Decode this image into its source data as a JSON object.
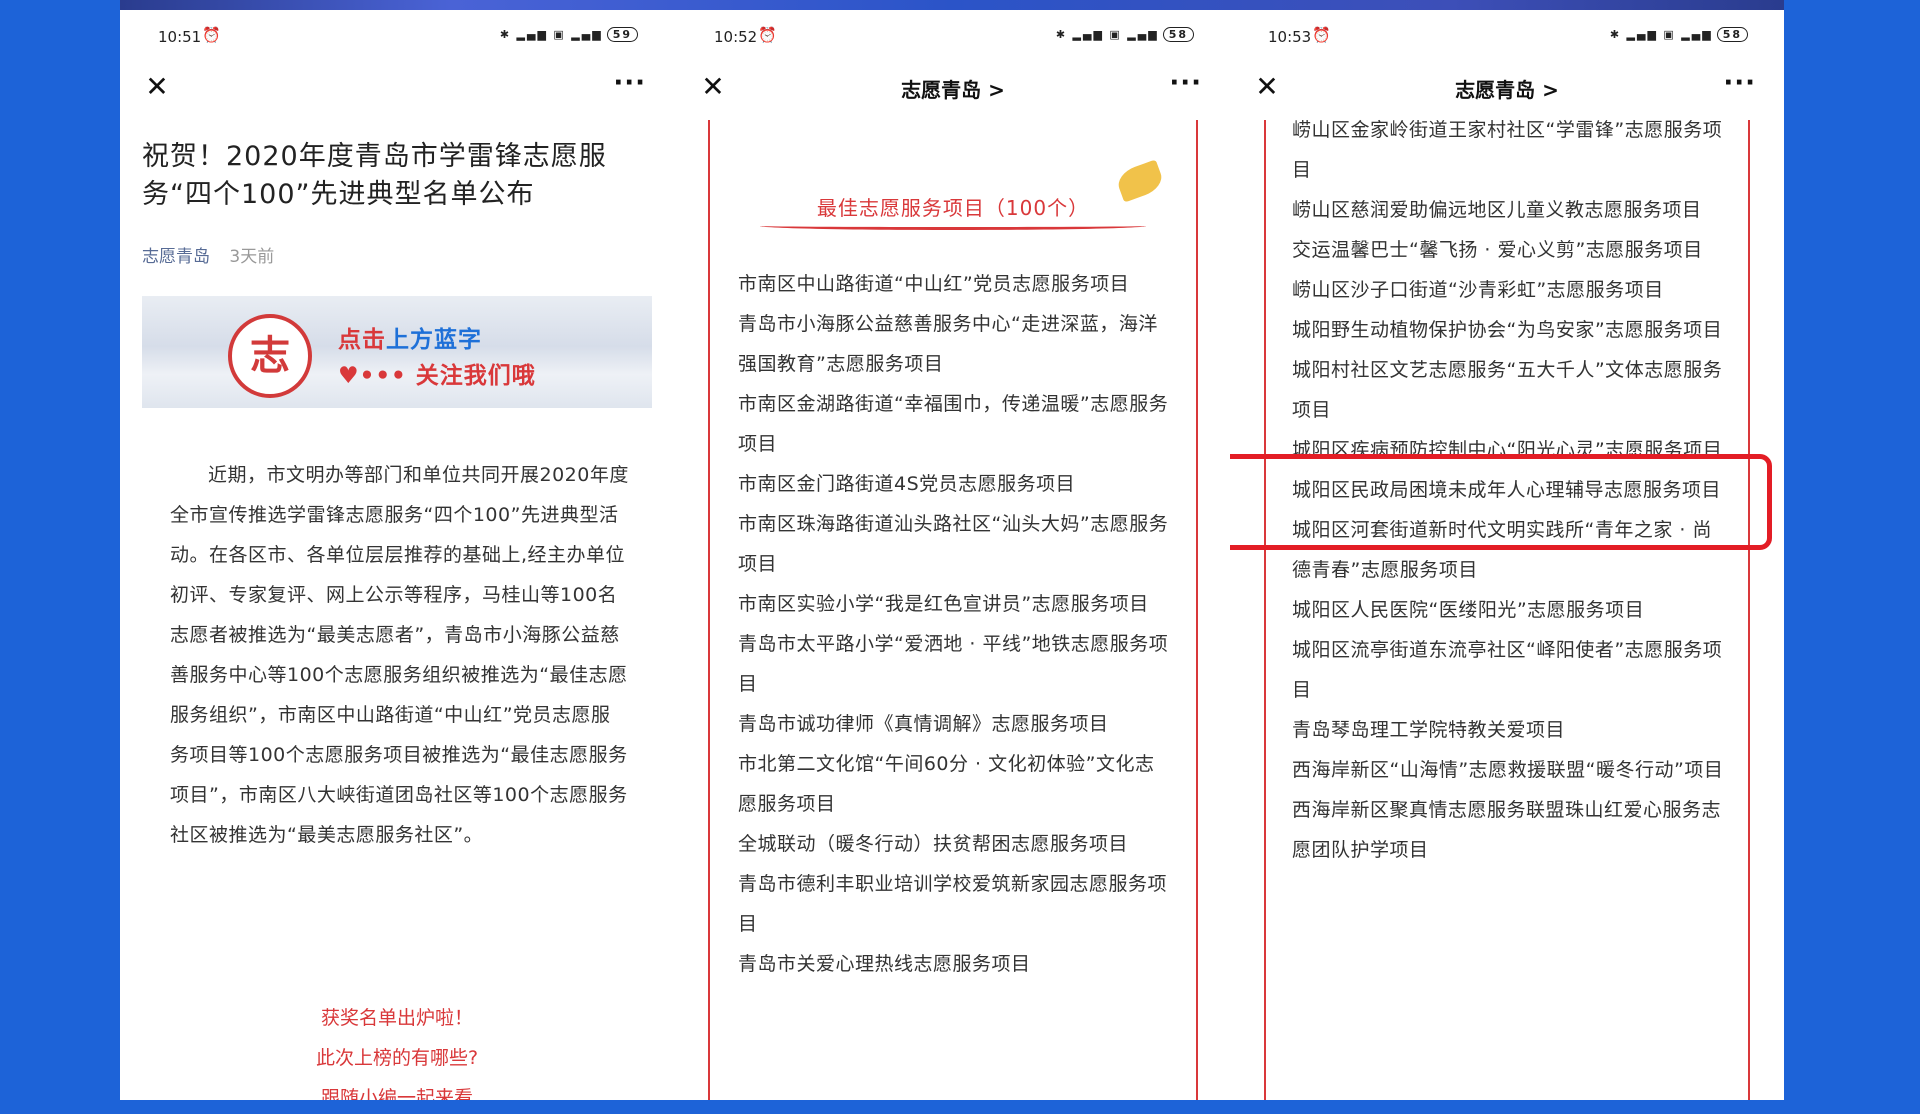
{
  "colors": {
    "background": "#1d63d8",
    "accent_red": "#d9383a",
    "link_blue": "#576b95",
    "highlight": "#e31d25"
  },
  "phone1": {
    "status": {
      "time": "10:51",
      "battery": "59"
    },
    "article": {
      "title": "祝贺！2020年度青岛市学雷锋志愿服务“四个100”先进典型名单公布",
      "account": "志愿青岛",
      "time_ago": "3天前",
      "banner": {
        "line1_part1": "点击",
        "line1_part2": "上方蓝字",
        "line2": "关注我们哦",
        "logo_icon": "volunteer-logo"
      },
      "body": "近期，市文明办等部门和单位共同开展2020年度全市宣传推选学雷锋志愿服务“四个100”先进典型活动。在各区市、各单位层层推荐的基础上,经主办单位初评、专家复评、网上公示等程序，马桂山等100名志愿者被推选为“最美志愿者”，青岛市小海豚公益慈善服务中心等100个志愿服务组织被推选为“最佳志愿服务组织”，市南区中山路街道“中山红”党员志愿服务项目等100个志愿服务项目被推选为“最佳志愿服务项目”，市南区八大峡街道团岛社区等100个志愿服务社区被推选为“最美志愿服务社区”。",
      "red_lines": [
        "获奖名单出炉啦！",
        "此次上榜的有哪些?",
        "跟随小编一起来看"
      ]
    }
  },
  "phone2": {
    "status": {
      "time": "10:52",
      "battery": "58"
    },
    "nav_title": "志愿青岛 >",
    "section_label": "最佳志愿服务项目（100个）",
    "items": [
      "市南区中山路街道“中山红”党员志愿服务项目",
      "青岛市小海豚公益慈善服务中心“走进深蓝，海洋强国教育”志愿服务项目",
      "市南区金湖路街道“幸福围巾，传递温暖”志愿服务项目",
      "市南区金门路街道4S党员志愿服务项目",
      "市南区珠海路街道汕头路社区“汕头大妈”志愿服务项目",
      "市南区实验小学“我是红色宣讲员”志愿服务项目",
      "青岛市太平路小学“爱洒地 · 平线”地铁志愿服务项目",
      "青岛市诚功律师《真情调解》志愿服务项目",
      "市北第二文化馆“午间60分 · 文化初体验”文化志愿服务项目",
      "全城联动（暖冬行动）扶贫帮困志愿服务项目",
      "青岛市德利丰职业培训学校爱筑新家园志愿服务项目",
      "青岛市关爱心理热线志愿服务项目"
    ]
  },
  "phone3": {
    "status": {
      "time": "10:53",
      "battery": "58"
    },
    "nav_title": "志愿青岛 >",
    "items": [
      "崂山区金家岭街道王家村社区“学雷锋”志愿服务项目",
      "崂山区慈润爱助偏远地区儿童义教志愿服务项目",
      "交运温馨巴士“馨飞扬 · 爱心义剪”志愿服务项目",
      "崂山区沙子口街道“沙青彩虹”志愿服务项目",
      "城阳野生动植物保护协会“为鸟安家”志愿服务项目",
      "城阳村社区文艺志愿服务“五大千人”文体志愿服务项目",
      "城阳区疾病预防控制中心“阳光心灵”志愿服务项目",
      "城阳区民政局困境未成年人心理辅导志愿服务项目",
      "城阳区河套街道新时代文明实践所“青年之家 · 尚德青春”志愿服务项目",
      "城阳区人民医院“医缕阳光”志愿服务项目",
      "城阳区流亭街道东流亭社区“峄阳使者”志愿服务项目",
      "青岛琴岛理工学院特教关爱项目",
      "西海岸新区“山海情”志愿救援联盟“暖冬行动”项目",
      "西海岸新区聚真情志愿服务联盟珠山红爱心服务志愿团队护学项目"
    ],
    "highlighted_item": 5
  }
}
